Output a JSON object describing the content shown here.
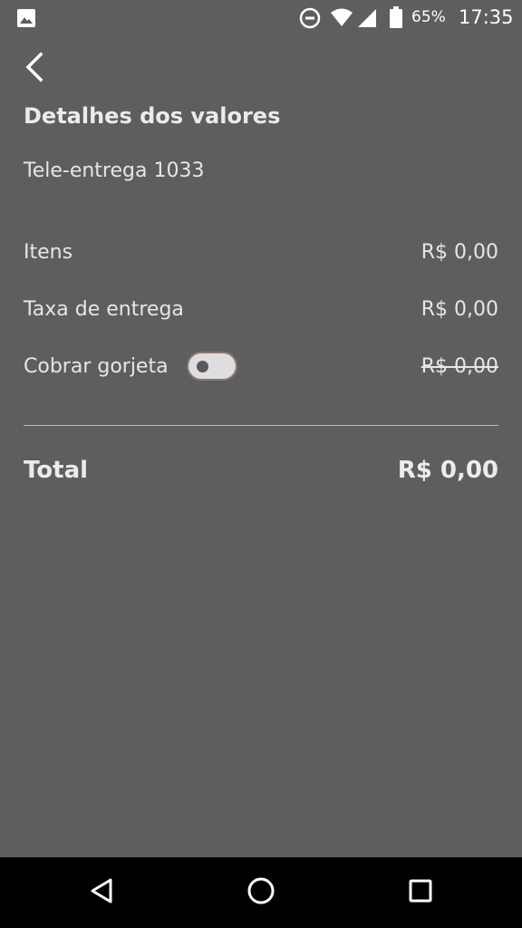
{
  "status_bar": {
    "battery": "65%",
    "time": "17:35",
    "icons": [
      "image-icon",
      "do-not-disturb-icon",
      "wifi-icon",
      "signal-icon",
      "battery-icon"
    ]
  },
  "header": {
    "back_icon": "chevron-left-icon",
    "title": "Detalhes dos valores"
  },
  "order": {
    "label": "Tele-entrega 1033"
  },
  "rows": {
    "itens": {
      "label": "Itens",
      "value": "R$ 0,00"
    },
    "taxa": {
      "label": "Taxa de entrega",
      "value": "R$ 0,00"
    },
    "gorjeta": {
      "label": "Cobrar gorjeta",
      "value": "R$ 0,00",
      "toggle_on": false
    }
  },
  "total": {
    "label": "Total",
    "value": "R$ 0,00"
  },
  "nav": {
    "icons": [
      "back-triangle-icon",
      "home-circle-icon",
      "recents-square-icon"
    ]
  },
  "colors": {
    "background": "#5e5e5e",
    "text": "#e6e6e6",
    "nav_bar": "#000000"
  }
}
